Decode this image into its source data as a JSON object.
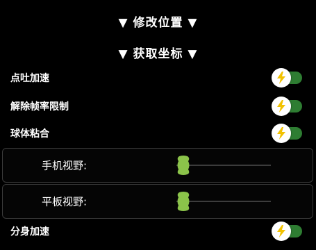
{
  "headers": {
    "modify_position": "▼ 修改位置 ▼",
    "get_coordinates": "▼ 获取坐标 ▼"
  },
  "toggles": [
    {
      "label": "点吐加速",
      "on": true
    },
    {
      "label": "解除帧率限制",
      "on": true
    },
    {
      "label": "球体粘合",
      "on": true
    },
    {
      "label": "分身加速",
      "on": true
    }
  ],
  "sliders": [
    {
      "label": "手机视野:",
      "value": 0
    },
    {
      "label": "平板视野:",
      "value": 0
    }
  ],
  "colors": {
    "toggle_track_on": "#2e7d32",
    "bolt_icon": "#f2c200",
    "slider_thumb": "#8bc34a",
    "background": "#000000"
  },
  "icons": {
    "toggle_knob": "lightning-bolt-icon"
  }
}
